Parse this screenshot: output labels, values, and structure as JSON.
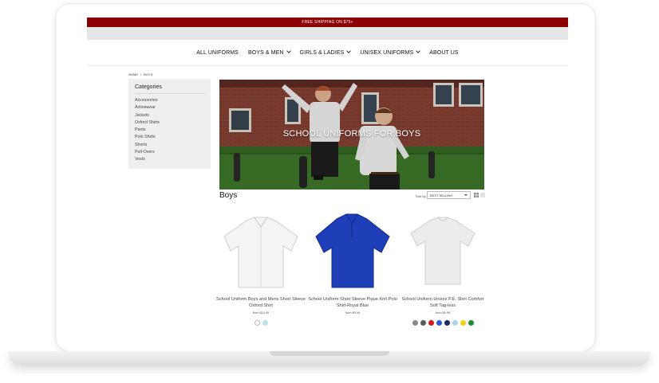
{
  "promo": {
    "text": "FREE SHIPPING ON $75+"
  },
  "nav": [
    {
      "label": "ALL UNIFORMS",
      "dropdown": false
    },
    {
      "label": "BOYS & MEN",
      "dropdown": true
    },
    {
      "label": "GIRLS & LADIES",
      "dropdown": true
    },
    {
      "label": "UNISEX UNIFORMS",
      "dropdown": true
    },
    {
      "label": "ABOUT US",
      "dropdown": false
    }
  ],
  "breadcrumb": {
    "home": "HOME",
    "separator": "/",
    "current": "BOYS"
  },
  "sidebar": {
    "title": "Categories",
    "items": [
      "Accessories",
      "Activewear",
      "Jackets",
      "Oxford Shirts",
      "Pants",
      "Polo Shirts",
      "Shorts",
      "Pull-Overs",
      "Vests"
    ]
  },
  "hero": {
    "title": "SCHOOL UNIFORMS FOR BOYS"
  },
  "listing": {
    "title": "Boys",
    "sort_label": "Sort by",
    "sort_value": "BEST SELLING"
  },
  "products": [
    {
      "name": "School Uniform Boys and Mens Short Sleeve Oxford Shirt",
      "price": "from $14.99",
      "shirt_color": "#f4f4f4",
      "swatches": [
        "#ffffff",
        "#bfe0ea"
      ]
    },
    {
      "name": "School Uniform Short Sleeve Pique Knit Polo Shirt-Royal Blue",
      "price": "from $9.99",
      "shirt_color": "#1f3fb8",
      "swatches": []
    },
    {
      "name": "School Uniform Unisex P.E. Shirt Comfort Soft Tag-less",
      "price": "from $5.99",
      "shirt_color": "#ececec",
      "swatches": [
        "#8a8a8a",
        "#5a5a5a",
        "#d01a1a",
        "#2c5ad6",
        "#1b2a6b",
        "#a8d4e8",
        "#f2cf10",
        "#1e8f2e"
      ]
    }
  ],
  "colors": {
    "promo_bg": "#8b0000",
    "sidebar_bg": "#efefef"
  }
}
